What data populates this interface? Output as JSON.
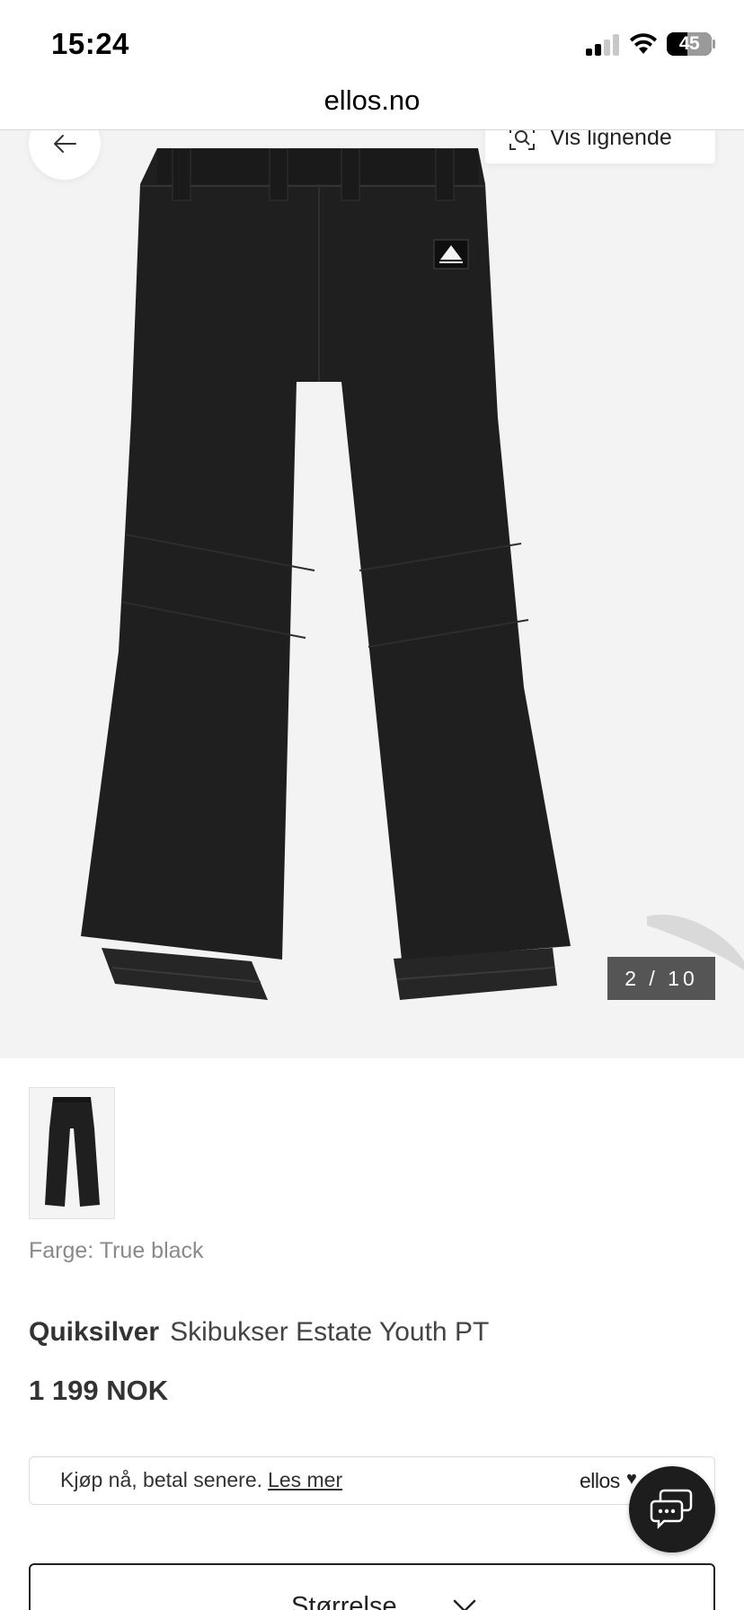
{
  "status_bar": {
    "time": "15:24",
    "battery_percent": "45",
    "battery_level": 0.45,
    "signal_bars_active": 2,
    "signal_bars_total": 4
  },
  "browser": {
    "url": "ellos.no"
  },
  "gallery": {
    "similar_label": "Vis lignende",
    "counter": "2 / 10",
    "current_index": 2,
    "total_images": 10
  },
  "product": {
    "color_label": "Farge: True black",
    "brand": "Quiksilver",
    "name": "Skibukser Estate Youth PT",
    "price": "1 199 NOK"
  },
  "payment": {
    "text": "Kjøp nå, betal senere.",
    "link": "Les mer",
    "provider_logo": "ellos",
    "provider_heart": "♥"
  },
  "size_selector": {
    "label": "Størrelse"
  },
  "colors": {
    "image_bg": "#f3f3f3",
    "counter_bg": "#555555",
    "chat_bg": "#1d1d1d",
    "pants": "#1f1f1f"
  },
  "icons": {
    "back": "arrow-left-icon",
    "similar": "visual-search-icon",
    "chat": "chat-bubble-icon",
    "size": "chevron-down-icon"
  }
}
